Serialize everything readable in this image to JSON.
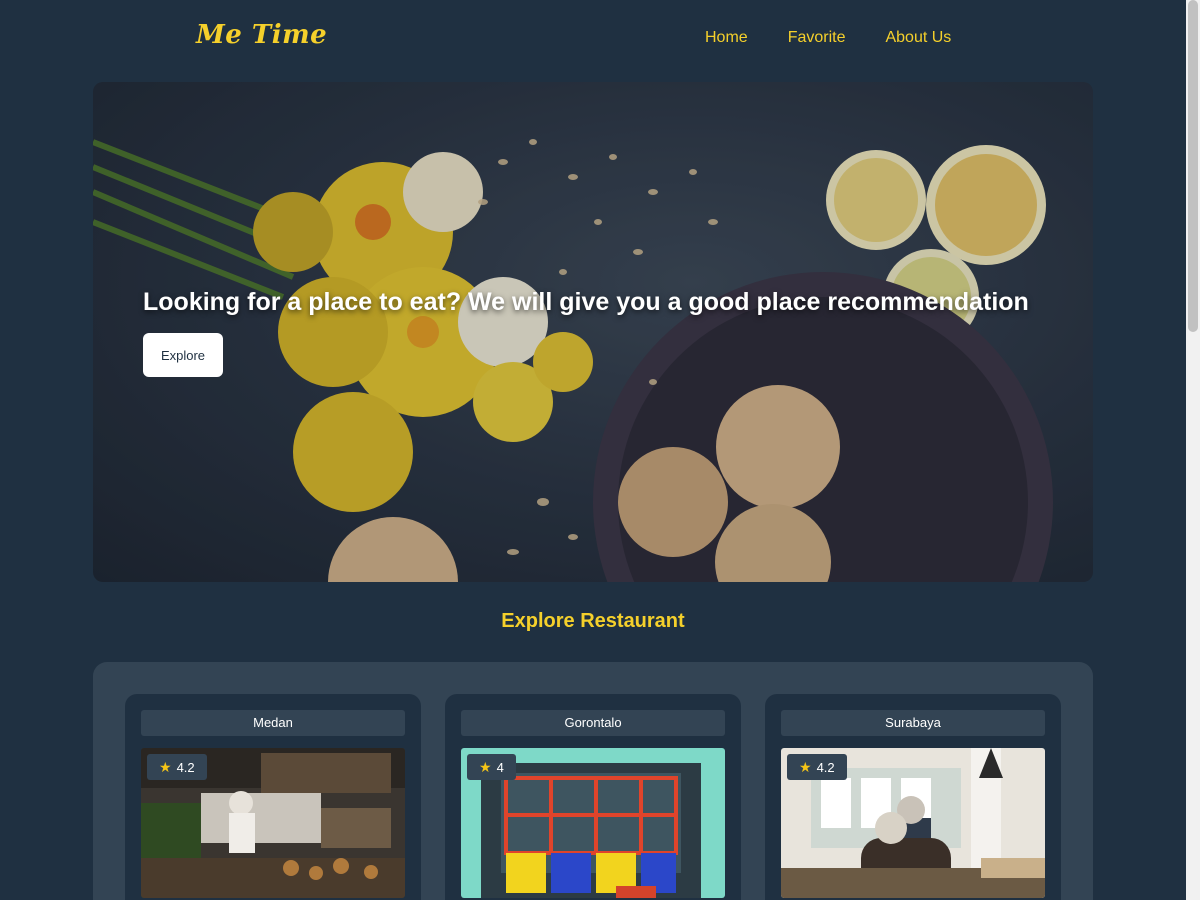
{
  "header": {
    "logo": "Me Time",
    "nav": [
      "Home",
      "Favorite",
      "About Us"
    ]
  },
  "hero": {
    "title": "Looking for a place to eat? We will give you a good place recommendation",
    "button_label": "Explore"
  },
  "section": {
    "title": "Explore Restaurant"
  },
  "restaurants": [
    {
      "city": "Medan",
      "rating": "4.2",
      "image": "cafe-counter-photo"
    },
    {
      "city": "Gorontalo",
      "rating": "4",
      "image": "colorful-window-photo"
    },
    {
      "city": "Surabaya",
      "rating": "4.2",
      "image": "cafe-interior-photo"
    }
  ],
  "colors": {
    "background": "#1f3041",
    "panel": "#334454",
    "accent": "#f5d02b"
  }
}
